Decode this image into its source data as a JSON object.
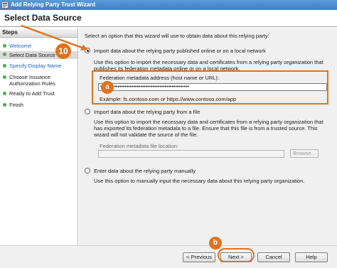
{
  "window": {
    "title": "Add Relying Party Trust Wizard"
  },
  "header": {
    "page_title": "Select Data Source"
  },
  "steps": {
    "heading": "Steps",
    "items": [
      {
        "label": "Welcome",
        "state": "done"
      },
      {
        "label": "Select Data Source",
        "state": "current"
      },
      {
        "label": "Specify Display Name",
        "state": "pending"
      },
      {
        "label": "Choose Issuance Authorization Rules",
        "state": "pending"
      },
      {
        "label": "Ready to Add Trust",
        "state": "pending"
      },
      {
        "label": "Finish",
        "state": "pending"
      }
    ]
  },
  "content": {
    "intro": "Select an option that this wizard will use to obtain data about this relying party:",
    "option_online": {
      "label": "Import data about the relying party published online or on a local network",
      "description": "Use this option to import the necessary data and certificates from a relying party organization that publishes its federation metadata online or on a local network.",
      "field_label": "Federation metadata address (host name or URL):",
      "field_value": "•••••••••••••••••••••••••••••••••••••••••••••••••••",
      "example": "Example: fs.contoso.com or https://www.contoso.com/app",
      "selected": true
    },
    "option_file": {
      "label": "Import data about the relying party from a file",
      "description": "Use this option to import the necessary data and certificates from a relying party organization that has exported its federation metadata to a file. Ensure that this file is from a trusted source. This wizard will not validate the source of the file.",
      "field_label": "Federation metadata file location:",
      "field_value": "",
      "browse_label": "Browse...",
      "selected": false
    },
    "option_manual": {
      "label": "Enter data about the relying party manually",
      "description": "Use this option to manually input the necessary data about this relying party organization.",
      "selected": false
    }
  },
  "footer": {
    "previous_label": "< Previous",
    "next_label": "Next >",
    "cancel_label": "Cancel",
    "help_label": "Help"
  },
  "annotations": {
    "step_number": "10",
    "marker_a": "a",
    "marker_b": "b",
    "color": "#e0731f"
  }
}
